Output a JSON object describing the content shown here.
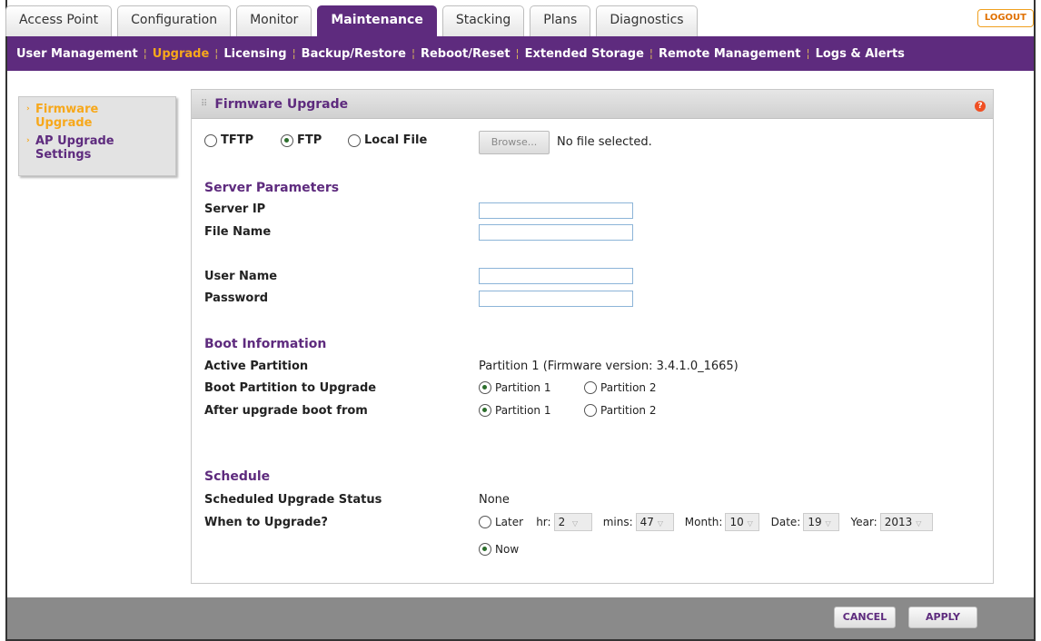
{
  "tabs": [
    "Access Point",
    "Configuration",
    "Monitor",
    "Maintenance",
    "Stacking",
    "Plans",
    "Diagnostics"
  ],
  "logout_label": "LOGOUT",
  "subnav": [
    "User Management",
    "Upgrade",
    "Licensing",
    "Backup/Restore",
    "Reboot/Reset",
    "Extended Storage",
    "Remote Management",
    "Logs & Alerts"
  ],
  "leftnav": {
    "firmware_upgrade": "Firmware Upgrade",
    "ap_upgrade_settings": "AP Upgrade Settings"
  },
  "panel": {
    "title": "Firmware Upgrade",
    "help_icon": "?"
  },
  "protocol": {
    "tftp": "TFTP",
    "ftp": "FTP",
    "local_file": "Local File",
    "selected": "FTP",
    "browse_label": "Browse...",
    "no_file": "No file selected."
  },
  "server": {
    "heading": "Server Parameters",
    "server_ip_label": "Server IP",
    "server_ip_value": "",
    "file_name_label": "File Name",
    "file_name_value": "",
    "user_name_label": "User Name",
    "user_name_value": "",
    "password_label": "Password",
    "password_value": ""
  },
  "boot": {
    "heading": "Boot Information",
    "active_partition_label": "Active Partition",
    "active_partition_value": "Partition 1 (Firmware version: 3.4.1.0_1665)",
    "boot_partition_label": "Boot Partition to Upgrade",
    "after_upgrade_label": "After upgrade boot from",
    "partition1": "Partition 1",
    "partition2": "Partition 2",
    "boot_partition_selected": "Partition 1",
    "after_upgrade_selected": "Partition 1"
  },
  "schedule": {
    "heading": "Schedule",
    "status_label": "Scheduled Upgrade Status",
    "status_value": "None",
    "when_label": "When to Upgrade?",
    "later": "Later",
    "now": "Now",
    "selected": "Now",
    "hr_label": "hr:",
    "hr_value": "2",
    "mins_label": "mins:",
    "mins_value": "47",
    "month_label": "Month:",
    "month_value": "10",
    "date_label": "Date:",
    "date_value": "19",
    "year_label": "Year:",
    "year_value": "2013"
  },
  "buttons": {
    "cancel": "CANCEL",
    "apply": "APPLY"
  },
  "colors": {
    "brand_purple": "#5e2b7e",
    "accent_orange": "#f7a81b",
    "footer_gray": "#8a8a8a"
  }
}
